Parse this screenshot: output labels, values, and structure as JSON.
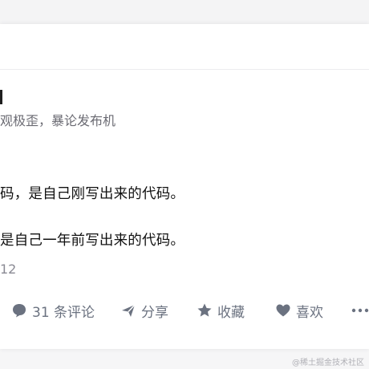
{
  "profile": {
    "bio": "观极歪，暴论发布机"
  },
  "post": {
    "line1": "码，是自己刚写出来的代码。",
    "line2": "是自己一年前写出来的代码。",
    "date": "12"
  },
  "actions": {
    "comments": "31 条评论",
    "share": "分享",
    "collect": "收藏",
    "like": "喜欢"
  },
  "watermark": "@稀土掘金技术社区",
  "colors": {
    "action_gray": "#6b7280",
    "text_dark": "#111111",
    "text_muted": "#6b6b73"
  },
  "icons": [
    "comment-icon",
    "share-icon",
    "star-icon",
    "heart-icon",
    "more-icon"
  ]
}
